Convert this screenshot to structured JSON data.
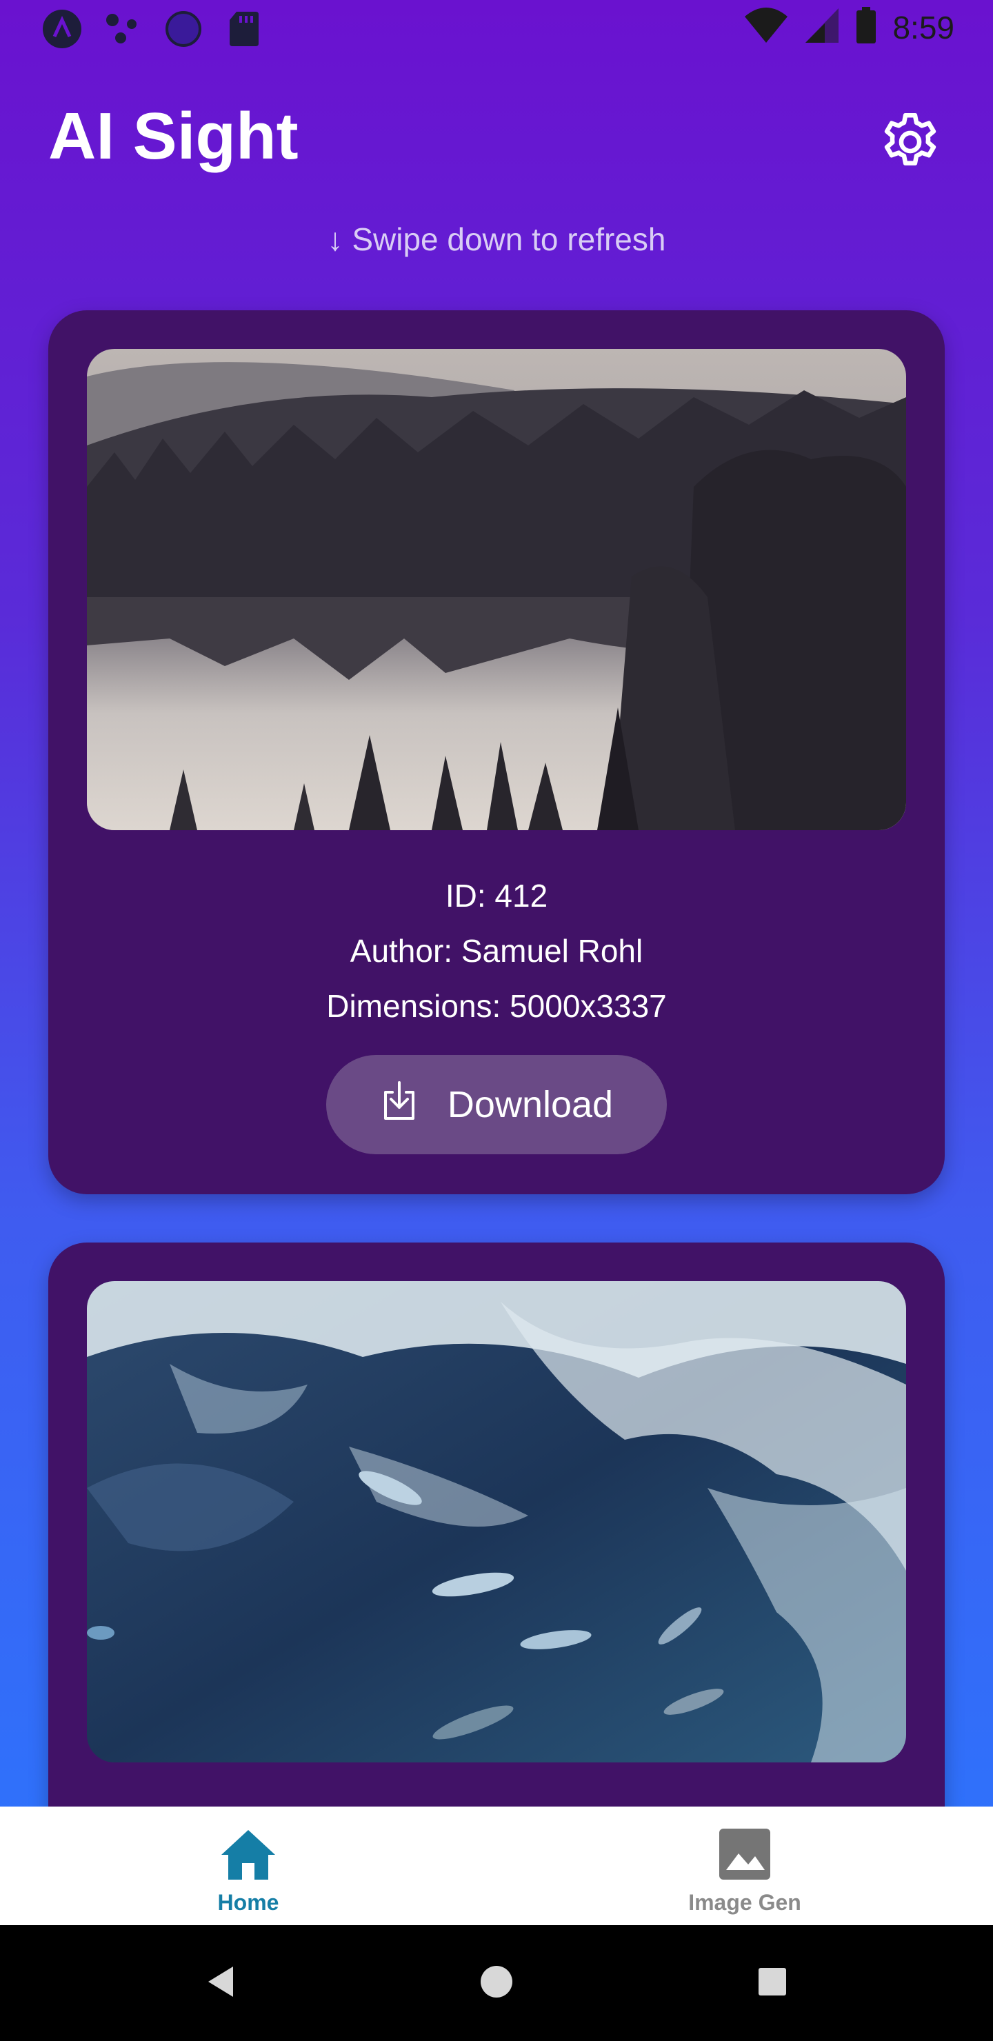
{
  "status_bar": {
    "time": "8:59",
    "left_icons": [
      "app-a-icon",
      "dots-icon",
      "circle-icon",
      "sd-card-icon"
    ],
    "right_icons": [
      "wifi-icon",
      "cell-signal-icon",
      "battery-icon"
    ]
  },
  "header": {
    "title": "AI Sight",
    "settings_icon": "gear-icon"
  },
  "refresh_hint": "↓ Swipe down to refresh",
  "cards": [
    {
      "image": "forest-lake-photo",
      "id_text": "ID: 412",
      "author_text": "Author: Samuel Rohl",
      "dimensions_text": "Dimensions: 5000x3337",
      "download_label": "Download",
      "download_icon": "download-icon"
    },
    {
      "image": "fish-water-photo"
    }
  ],
  "bottom_nav": {
    "items": [
      {
        "label": "Home",
        "icon": "home-icon",
        "active": true
      },
      {
        "label": "Image Gen",
        "icon": "image-icon",
        "active": false
      }
    ]
  },
  "colors": {
    "gradient_top": "#6a12cf",
    "gradient_bottom": "#2979ff",
    "card_bg": "#411267",
    "button_bg": "#6a4a86",
    "nav_active": "#157ea6",
    "nav_inactive": "#8a8a8a"
  }
}
